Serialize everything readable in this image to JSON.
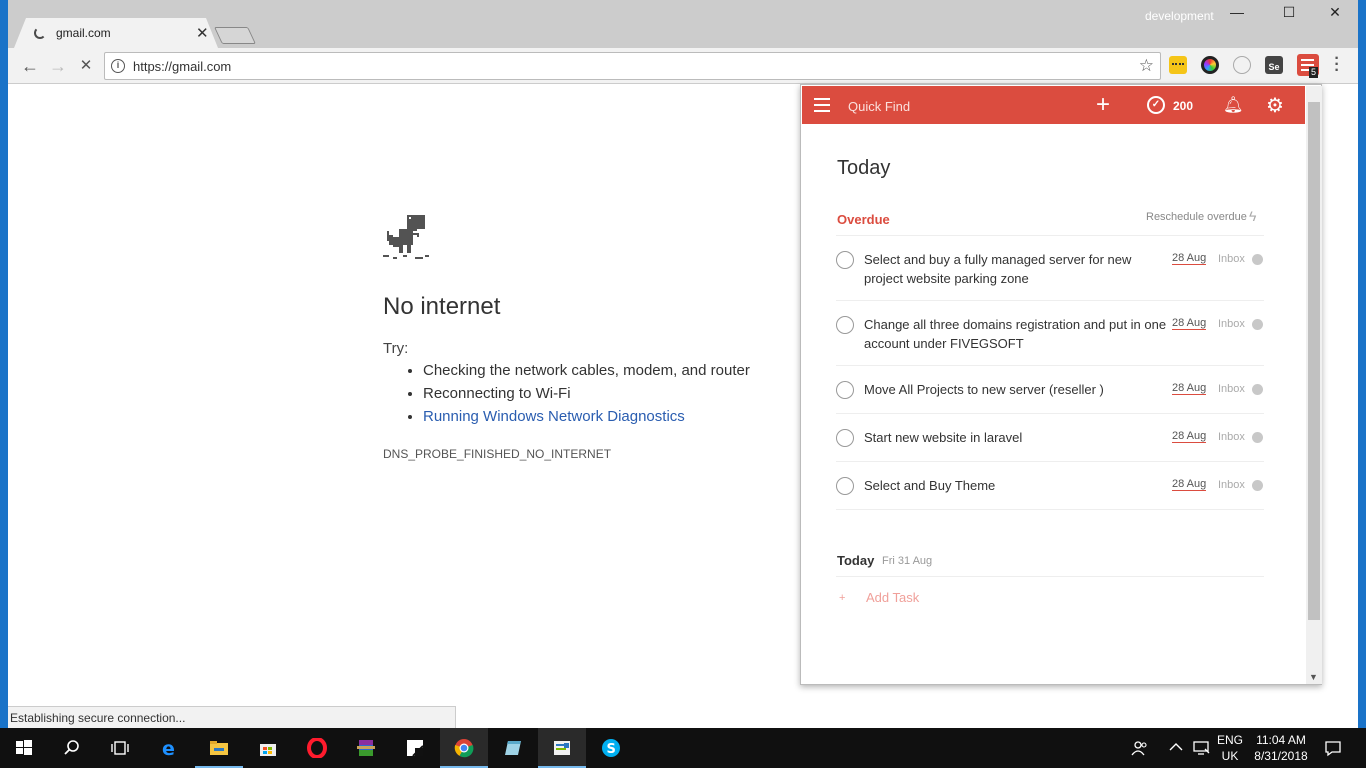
{
  "browser": {
    "tab_title": "gmail.com",
    "tab_close": "✕",
    "profile_name": "development",
    "window_controls": {
      "minimize": "—",
      "maximize": "☐",
      "close": "✕"
    },
    "nav": {
      "back": "←",
      "forward": "→",
      "stop": "✕"
    },
    "url": "https://gmail.com",
    "info_icon_glyph": "i",
    "star_glyph": "☆",
    "extension_badge": "5",
    "status_text": "Establishing secure connection..."
  },
  "error_page": {
    "heading": "No internet",
    "try_label": "Try:",
    "suggestions": [
      "Checking the network cables, modem, and router",
      "Reconnecting to Wi-Fi"
    ],
    "diagnostics_link": "Running Windows Network Diagnostics",
    "error_code": "DNS_PROBE_FINISHED_NO_INTERNET"
  },
  "todoist": {
    "accent_color": "#db4c3f",
    "quick_find": "Quick Find",
    "add_glyph": "+",
    "karma": "200",
    "view_title": "Today",
    "overdue_label": "Overdue",
    "reschedule_label": "Reschedule overdue",
    "tasks": [
      {
        "text": "Select and buy a fully managed server for new project website parking zone",
        "date": "28 Aug",
        "project": "Inbox"
      },
      {
        "text": "Change all three domains registration and put in one account under FIVEGSOFT",
        "date": "28 Aug",
        "project": "Inbox"
      },
      {
        "text": "Move All Projects to new server (reseller )",
        "date": "28 Aug",
        "project": "Inbox"
      },
      {
        "text": "Start new website in laravel",
        "date": "28 Aug",
        "project": "Inbox"
      },
      {
        "text": "Select and Buy Theme",
        "date": "28 Aug",
        "project": "Inbox"
      }
    ],
    "today_section": {
      "label": "Today",
      "date": "Fri 31 Aug"
    },
    "add_task": "Add Task"
  },
  "taskbar": {
    "language_top": "ENG",
    "language_bottom": "UK",
    "time": "11:04 AM",
    "date": "8/31/2018",
    "icons": [
      "windows-start-icon",
      "search-icon",
      "task-view-icon",
      "edge-icon",
      "file-explorer-icon",
      "store-icon",
      "opera-icon",
      "winrar-icon",
      "sticky-notes-icon",
      "chrome-icon",
      "notepad-icon",
      "paint-icon",
      "skype-icon"
    ]
  }
}
